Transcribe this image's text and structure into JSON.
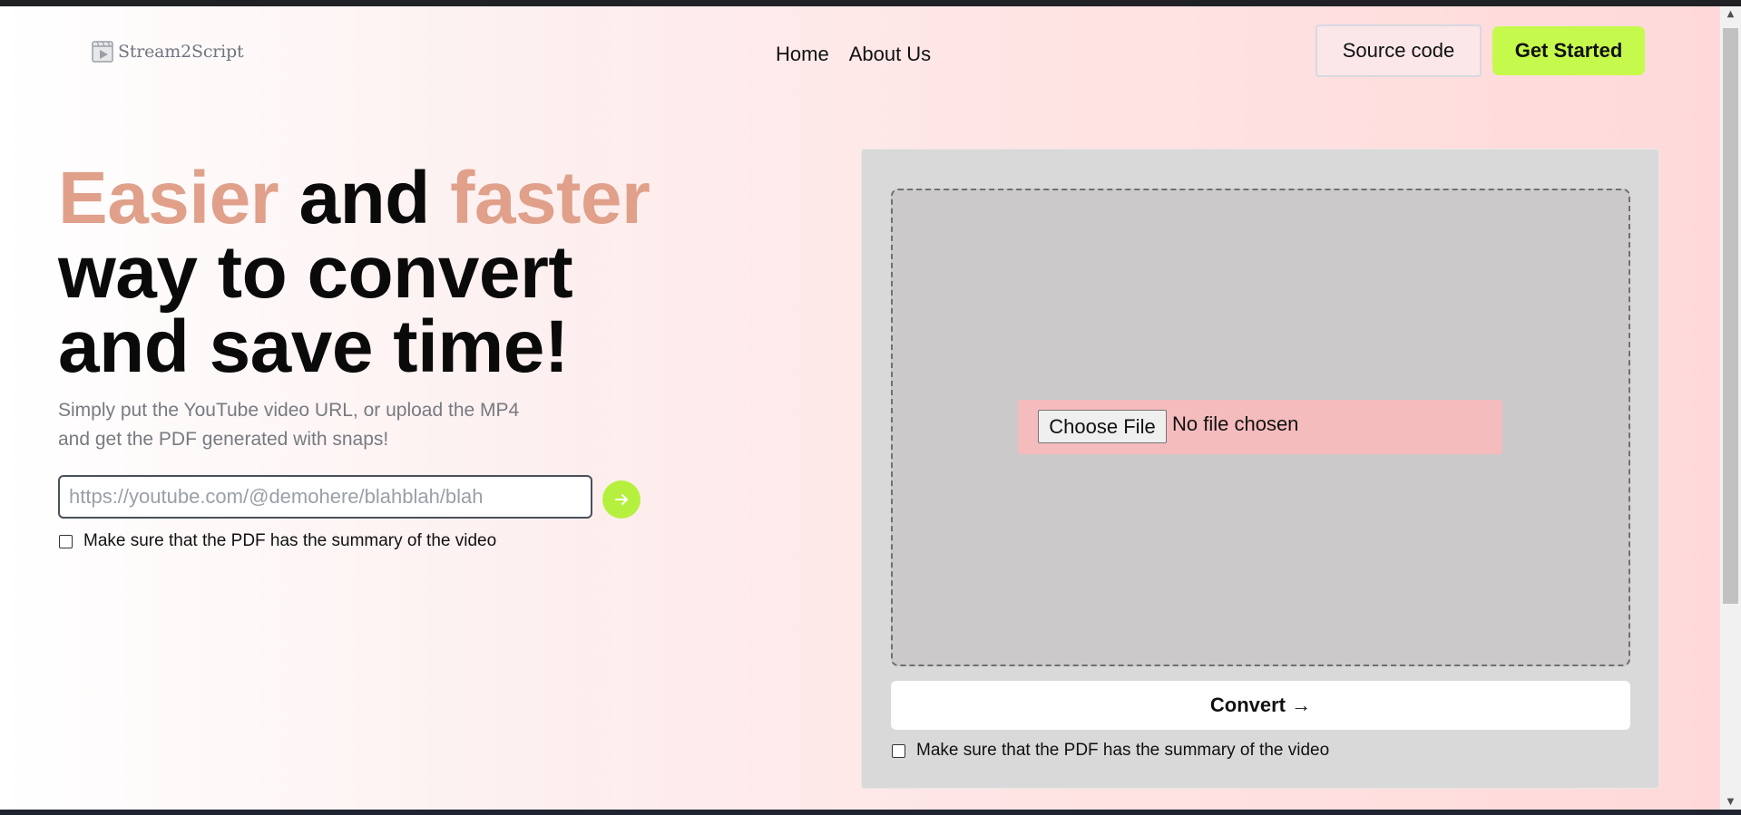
{
  "header": {
    "logo_text": "Stream2Script",
    "nav": [
      {
        "label": "Home"
      },
      {
        "label": "About Us"
      }
    ],
    "source_code_label": "Source code",
    "get_started_label": "Get Started"
  },
  "hero": {
    "title_line1_word1": "Easier",
    "title_line1_word2": " and ",
    "title_line1_word3": "faster",
    "title_line2": "way to convert",
    "title_line3": "and save time!",
    "subtitle": "Simply put the YouTube video URL, or upload the MP4 and get the PDF generated with snaps!",
    "url_placeholder": "https://youtube.com/@demohere/blahblah/blah",
    "go_icon": "arrow-right-icon",
    "summary_checkbox_label": "Make sure that the PDF has the summary of the video"
  },
  "upload": {
    "choose_file_label": "Choose File",
    "file_status": "No file chosen",
    "convert_label": "Convert →",
    "summary_checkbox_label": "Make sure that the PDF has the summary of the video"
  },
  "colors": {
    "accent_peach": "#e0a08a",
    "accent_lime": "#c5fa4c",
    "panel_bg": "#d9d9d9",
    "file_box_bg": "#f5bcbd"
  }
}
